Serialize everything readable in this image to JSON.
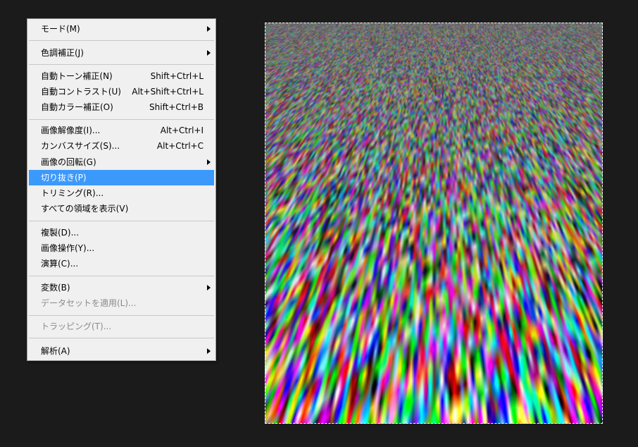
{
  "menu": {
    "items": [
      {
        "label": "モード(M)",
        "shortcut": "",
        "submenu": true,
        "enabled": true,
        "highlighted": false
      },
      {
        "label": "色調補正(J)",
        "shortcut": "",
        "submenu": true,
        "enabled": true,
        "highlighted": false
      },
      {
        "label": "自動トーン補正(N)",
        "shortcut": "Shift+Ctrl+L",
        "submenu": false,
        "enabled": true,
        "highlighted": false
      },
      {
        "label": "自動コントラスト(U)",
        "shortcut": "Alt+Shift+Ctrl+L",
        "submenu": false,
        "enabled": true,
        "highlighted": false
      },
      {
        "label": "自動カラー補正(O)",
        "shortcut": "Shift+Ctrl+B",
        "submenu": false,
        "enabled": true,
        "highlighted": false
      },
      {
        "label": "画像解像度(I)...",
        "shortcut": "Alt+Ctrl+I",
        "submenu": false,
        "enabled": true,
        "highlighted": false
      },
      {
        "label": "カンバスサイズ(S)...",
        "shortcut": "Alt+Ctrl+C",
        "submenu": false,
        "enabled": true,
        "highlighted": false
      },
      {
        "label": "画像の回転(G)",
        "shortcut": "",
        "submenu": true,
        "enabled": true,
        "highlighted": false
      },
      {
        "label": "切り抜き(P)",
        "shortcut": "",
        "submenu": false,
        "enabled": true,
        "highlighted": true
      },
      {
        "label": "トリミング(R)...",
        "shortcut": "",
        "submenu": false,
        "enabled": true,
        "highlighted": false
      },
      {
        "label": "すべての領域を表示(V)",
        "shortcut": "",
        "submenu": false,
        "enabled": true,
        "highlighted": false
      },
      {
        "label": "複製(D)...",
        "shortcut": "",
        "submenu": false,
        "enabled": true,
        "highlighted": false
      },
      {
        "label": "画像操作(Y)...",
        "shortcut": "",
        "submenu": false,
        "enabled": true,
        "highlighted": false
      },
      {
        "label": "演算(C)...",
        "shortcut": "",
        "submenu": false,
        "enabled": true,
        "highlighted": false
      },
      {
        "label": "変数(B)",
        "shortcut": "",
        "submenu": true,
        "enabled": true,
        "highlighted": false
      },
      {
        "label": "データセットを適用(L)...",
        "shortcut": "",
        "submenu": false,
        "enabled": false,
        "highlighted": false
      },
      {
        "label": "トラッピング(T)...",
        "shortcut": "",
        "submenu": false,
        "enabled": false,
        "highlighted": false
      },
      {
        "label": "解析(A)",
        "shortcut": "",
        "submenu": true,
        "enabled": true,
        "highlighted": false
      }
    ]
  },
  "colors": {
    "workspace": "#1b1b1b",
    "menu_bg": "#f0f0f0",
    "highlight": "#3b99fc",
    "disabled_text": "#8a8a8a"
  },
  "canvas": {
    "content": "rgb-noise-perspective",
    "selection": "marching-ants"
  }
}
